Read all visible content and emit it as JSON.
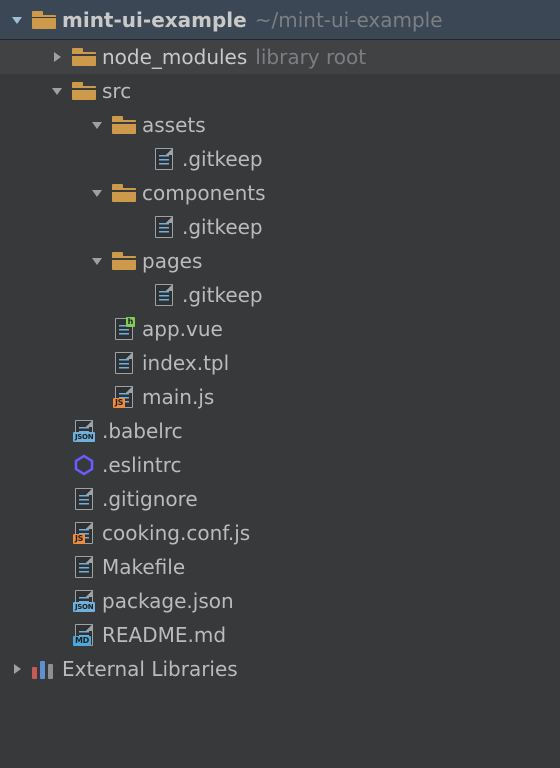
{
  "root": {
    "name": "mint-ui-example",
    "path": "~/mint-ui-example"
  },
  "node_modules": {
    "name": "node_modules",
    "tag": "library root"
  },
  "src": {
    "name": "src"
  },
  "assets": {
    "name": "assets",
    "gitkeep": ".gitkeep"
  },
  "components": {
    "name": "components",
    "gitkeep": ".gitkeep"
  },
  "pages": {
    "name": "pages",
    "gitkeep": ".gitkeep"
  },
  "src_files": {
    "app_vue": "app.vue",
    "index_tpl": "index.tpl",
    "main_js": "main.js"
  },
  "root_files": {
    "babelrc": ".babelrc",
    "eslintrc": ".eslintrc",
    "gitignore": ".gitignore",
    "cooking": "cooking.conf.js",
    "makefile": "Makefile",
    "package_json": "package.json",
    "readme": "README.md"
  },
  "external_libraries": "External Libraries"
}
